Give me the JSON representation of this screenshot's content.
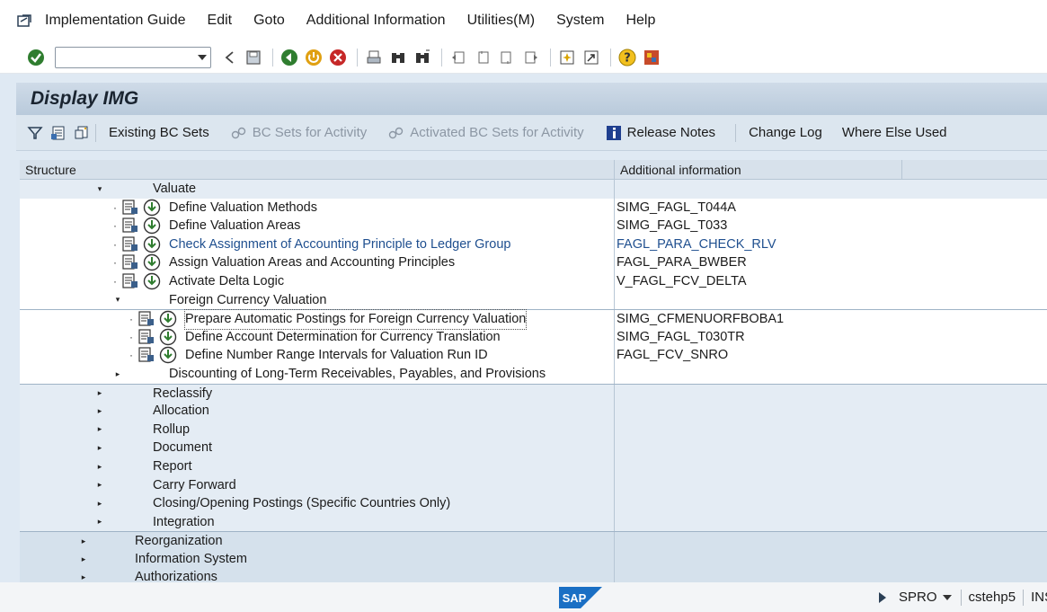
{
  "menu": {
    "items": [
      {
        "label": "Implementation Guide",
        "name": "menu-implementation-guide"
      },
      {
        "label": "Edit",
        "name": "menu-edit"
      },
      {
        "label": "Goto",
        "name": "menu-goto"
      },
      {
        "label": "Additional Information",
        "name": "menu-additional-information"
      },
      {
        "label": "Utilities(M)",
        "name": "menu-utilities"
      },
      {
        "label": "System",
        "name": "menu-system"
      },
      {
        "label": "Help",
        "name": "menu-help"
      }
    ]
  },
  "toolbar": {
    "command_value": "",
    "icons": [
      "enter-icon",
      "back-icon",
      "save-icon",
      "exit-icon",
      "cancel-icon",
      "print-icon",
      "find-icon",
      "find-next-icon",
      "first-page-icon",
      "previous-page-icon",
      "next-page-icon",
      "last-page-icon",
      "new-session-icon",
      "shortcut-icon",
      "help-icon",
      "customize-layout-icon"
    ]
  },
  "title": "Display IMG",
  "app_toolbar": {
    "existing_bc_sets": "Existing BC Sets",
    "bc_sets_for_activity": "BC Sets for Activity",
    "activated_bc_sets": "Activated BC Sets for Activity",
    "release_notes": "Release Notes",
    "change_log": "Change Log",
    "where_else_used": "Where Else Used"
  },
  "tree": {
    "header_structure": "Structure",
    "header_info": "Additional information",
    "rows": [
      {
        "label": "Valuate",
        "info": "",
        "level": 4,
        "toggle": "expanded",
        "activity": false
      },
      {
        "label": "Define Valuation Methods",
        "info": "SIMG_FAGL_T044A",
        "level": 5,
        "activity": true
      },
      {
        "label": "Define Valuation Areas",
        "info": "SIMG_FAGL_T033",
        "level": 5,
        "activity": true
      },
      {
        "label": "Check Assignment of Accounting Principle to Ledger Group",
        "info": "FAGL_PARA_CHECK_RLV",
        "level": 5,
        "activity": true,
        "link": true
      },
      {
        "label": "Assign Valuation Areas and Accounting Principles",
        "info": "FAGL_PARA_BWBER",
        "level": 5,
        "activity": true
      },
      {
        "label": "Activate Delta Logic",
        "info": "V_FAGL_FCV_DELTA",
        "level": 5,
        "activity": true
      },
      {
        "label": "Foreign Currency Valuation",
        "info": "",
        "level": 5,
        "toggle": "expanded",
        "activity": false
      },
      {
        "label": "Prepare Automatic Postings for Foreign Currency Valuation",
        "info": "SIMG_CFMENUORFBOBA1",
        "level": 6,
        "activity": true,
        "selected": true
      },
      {
        "label": "Define Account Determination for Currency Translation",
        "info": "SIMG_FAGL_T030TR",
        "level": 6,
        "activity": true
      },
      {
        "label": "Define Number Range Intervals for Valuation Run ID",
        "info": "FAGL_FCV_SNRO",
        "level": 6,
        "activity": true
      },
      {
        "label": "Discounting of Long-Term Receivables, Payables, and Provisions",
        "info": "",
        "level": 5,
        "toggle": "collapsed",
        "activity": false
      },
      {
        "label": "Reclassify",
        "info": "",
        "level": 4,
        "toggle": "collapsed",
        "activity": false
      },
      {
        "label": "Allocation",
        "info": "",
        "level": 4,
        "toggle": "collapsed",
        "activity": false
      },
      {
        "label": "Rollup",
        "info": "",
        "level": 4,
        "toggle": "collapsed",
        "activity": false
      },
      {
        "label": "Document",
        "info": "",
        "level": 4,
        "toggle": "collapsed",
        "activity": false
      },
      {
        "label": "Report",
        "info": "",
        "level": 4,
        "toggle": "collapsed",
        "activity": false
      },
      {
        "label": "Carry Forward",
        "info": "",
        "level": 4,
        "toggle": "collapsed",
        "activity": false
      },
      {
        "label": "Closing/Opening Postings (Specific Countries Only)",
        "info": "",
        "level": 4,
        "toggle": "collapsed",
        "activity": false
      },
      {
        "label": "Integration",
        "info": "",
        "level": 4,
        "toggle": "collapsed",
        "activity": false
      },
      {
        "label": "Reorganization",
        "info": "",
        "level": 3,
        "toggle": "collapsed",
        "activity": false
      },
      {
        "label": "Information System",
        "info": "",
        "level": 3,
        "toggle": "collapsed",
        "activity": false
      },
      {
        "label": "Authorizations",
        "info": "",
        "level": 3,
        "toggle": "collapsed",
        "activity": false
      }
    ]
  },
  "status": {
    "logo_text": "SAP",
    "transaction": "SPRO",
    "server": "cstehp5",
    "mode": "INS"
  }
}
